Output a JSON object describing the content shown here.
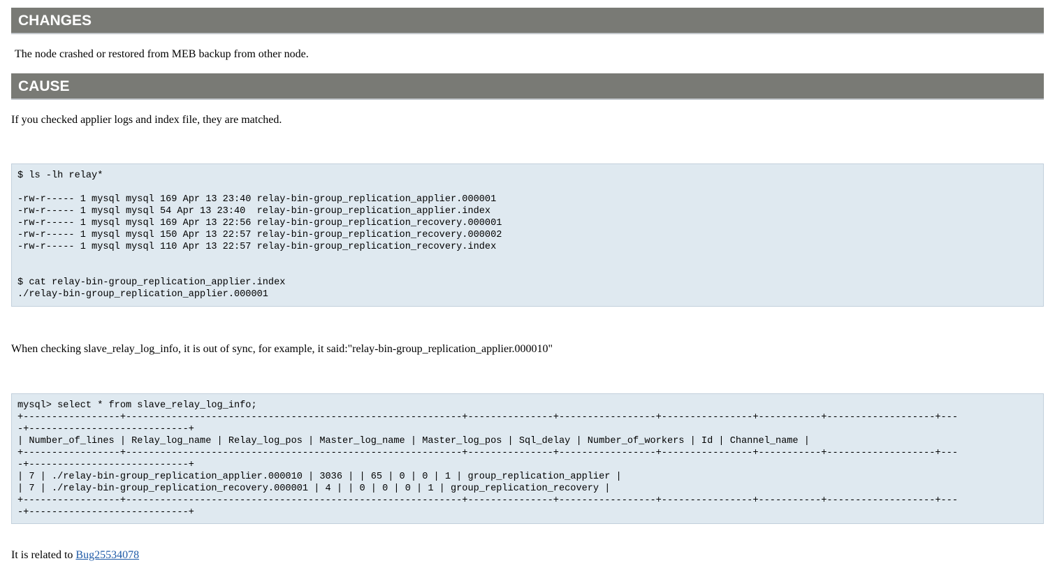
{
  "changes": {
    "heading": "CHANGES",
    "text": "The node crashed or restored from MEB backup from other node."
  },
  "cause": {
    "heading": "CAUSE",
    "intro": "If you checked applier logs and index file, they are matched.",
    "code1": "$ ls -lh relay*\n\n-rw-r----- 1 mysql mysql 169 Apr 13 23:40 relay-bin-group_replication_applier.000001\n-rw-r----- 1 mysql mysql 54 Apr 13 23:40  relay-bin-group_replication_applier.index\n-rw-r----- 1 mysql mysql 169 Apr 13 22:56 relay-bin-group_replication_recovery.000001\n-rw-r----- 1 mysql mysql 150 Apr 13 22:57 relay-bin-group_replication_recovery.000002\n-rw-r----- 1 mysql mysql 110 Apr 13 22:57 relay-bin-group_replication_recovery.index\n\n\n$ cat relay-bin-group_replication_applier.index\n./relay-bin-group_replication_applier.000001",
    "sync_text": "When checking slave_relay_log_info, it is out of sync, for example, it said:\"relay-bin-group_replication_applier.000010\"",
    "code2": "mysql> select * from slave_relay_log_info;\n+-----------------+-----------------------------------------------------------+---------------+-----------------+----------------+-----------+-------------------+---\n-+----------------------------+\n| Number_of_lines | Relay_log_name | Relay_log_pos | Master_log_name | Master_log_pos | Sql_delay | Number_of_workers | Id | Channel_name |\n+-----------------+-----------------------------------------------------------+---------------+-----------------+----------------+-----------+-------------------+---\n-+----------------------------+\n| 7 | ./relay-bin-group_replication_applier.000010 | 3036 | | 65 | 0 | 0 | 1 | group_replication_applier |\n| 7 | ./relay-bin-group_replication_recovery.000001 | 4 | | 0 | 0 | 0 | 1 | group_replication_recovery |\n+-----------------+-----------------------------------------------------------+---------------+-----------------+----------------+-----------+-------------------+---\n-+----------------------------+",
    "related_prefix": "It is related to ",
    "related_link": "Bug25534078"
  }
}
